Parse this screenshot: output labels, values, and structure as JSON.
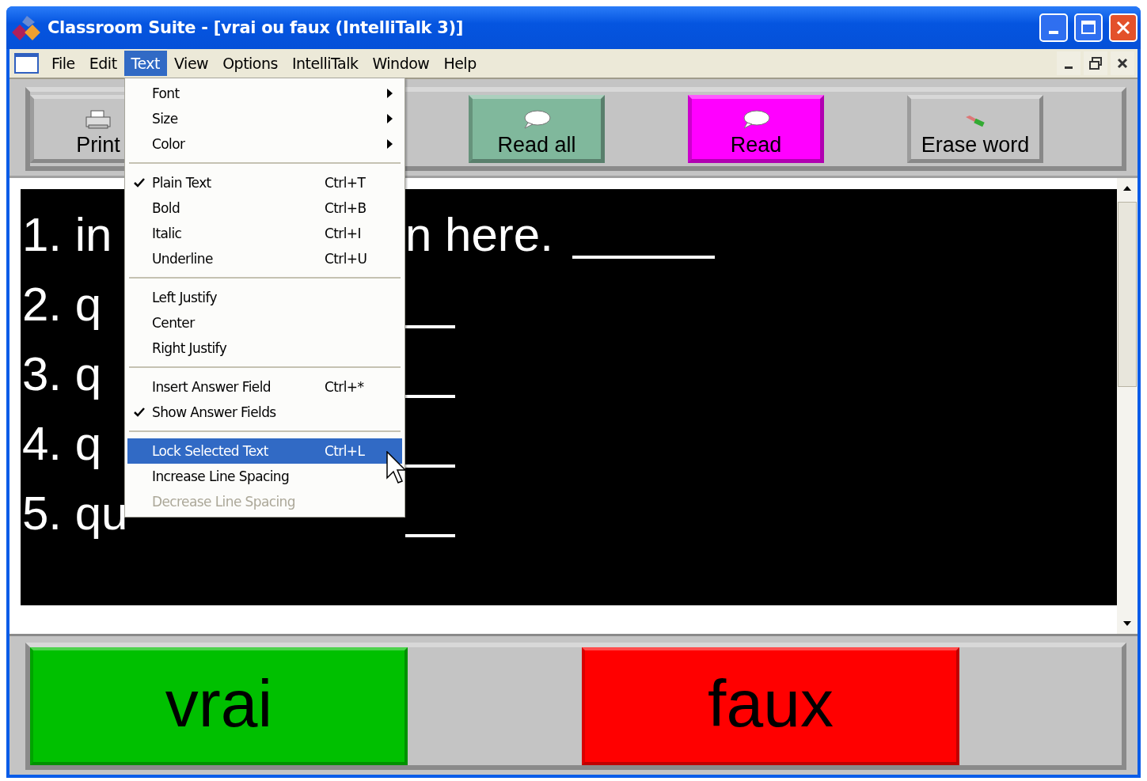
{
  "window": {
    "title": "Classroom Suite - [vrai ou faux (IntelliTalk 3)]"
  },
  "menu_bar": [
    {
      "label": "File",
      "selected": false
    },
    {
      "label": "Edit",
      "selected": false
    },
    {
      "label": "Text",
      "selected": true
    },
    {
      "label": "View",
      "selected": false
    },
    {
      "label": "Options",
      "selected": false
    },
    {
      "label": "IntelliTalk",
      "selected": false
    },
    {
      "label": "Window",
      "selected": false
    },
    {
      "label": "Help",
      "selected": false
    }
  ],
  "toolbar": [
    {
      "label": "Print",
      "color": "#c4c4c4"
    },
    {
      "label": "Read all",
      "color": "#80b89c"
    },
    {
      "label": "Read",
      "color": "#ff00ff"
    },
    {
      "label": "Erase word",
      "color": "#c4c4c4"
    }
  ],
  "document": {
    "lines": [
      {
        "text": "1. in",
        "after": "n  here."
      },
      {
        "text": "2. q"
      },
      {
        "text": "3. q"
      },
      {
        "text": "4. q"
      },
      {
        "text": "5. qu"
      }
    ]
  },
  "text_menu": [
    {
      "kind": "item",
      "label": "Font",
      "submenu": true,
      "checked": false,
      "selected": false,
      "disabled": false
    },
    {
      "kind": "item",
      "label": "Size",
      "submenu": true,
      "checked": false,
      "selected": false,
      "disabled": false
    },
    {
      "kind": "item",
      "label": "Color",
      "submenu": true,
      "checked": false,
      "selected": false,
      "disabled": false
    },
    {
      "kind": "separator"
    },
    {
      "kind": "item",
      "label": "Plain Text",
      "shortcut": "Ctrl+T",
      "checked": true,
      "selected": false,
      "disabled": false
    },
    {
      "kind": "item",
      "label": "Bold",
      "shortcut": "Ctrl+B",
      "checked": false,
      "selected": false,
      "disabled": false
    },
    {
      "kind": "item",
      "label": "Italic",
      "shortcut": "Ctrl+I",
      "checked": false,
      "selected": false,
      "disabled": false
    },
    {
      "kind": "item",
      "label": "Underline",
      "shortcut": "Ctrl+U",
      "checked": false,
      "selected": false,
      "disabled": false
    },
    {
      "kind": "separator"
    },
    {
      "kind": "item",
      "label": "Left Justify",
      "checked": false,
      "selected": false,
      "disabled": false
    },
    {
      "kind": "item",
      "label": "Center",
      "checked": false,
      "selected": false,
      "disabled": false
    },
    {
      "kind": "item",
      "label": "Right Justify",
      "checked": false,
      "selected": false,
      "disabled": false
    },
    {
      "kind": "separator"
    },
    {
      "kind": "item",
      "label": "Insert Answer Field",
      "shortcut": "Ctrl+*",
      "checked": false,
      "selected": false,
      "disabled": false
    },
    {
      "kind": "item",
      "label": "Show Answer Fields",
      "checked": true,
      "selected": false,
      "disabled": false
    },
    {
      "kind": "separator"
    },
    {
      "kind": "item",
      "label": "Lock Selected Text",
      "shortcut": "Ctrl+L",
      "checked": false,
      "selected": true,
      "disabled": false
    },
    {
      "kind": "item",
      "label": "Increase Line Spacing",
      "checked": false,
      "selected": false,
      "disabled": false
    },
    {
      "kind": "item",
      "label": "Decrease Line Spacing",
      "checked": false,
      "selected": false,
      "disabled": true
    }
  ],
  "answer_buttons": [
    {
      "label": "vrai",
      "color": "#00c000"
    },
    {
      "label": "faux",
      "color": "#ff0000"
    }
  ]
}
